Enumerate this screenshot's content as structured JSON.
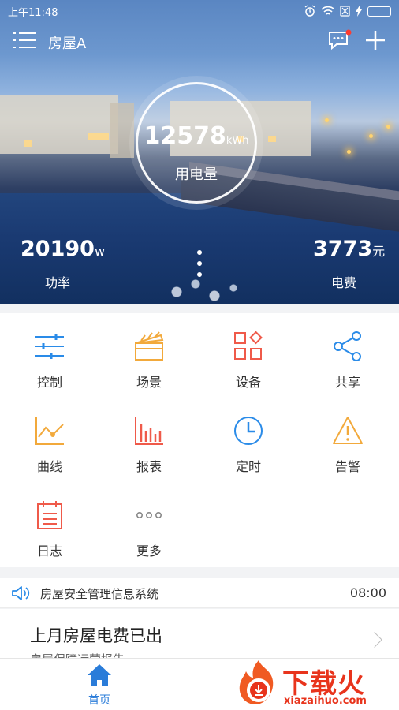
{
  "status_bar": {
    "time": "上午11:48",
    "battery_level": 1.0
  },
  "header": {
    "house_name": "房屋A",
    "has_unread_messages": true
  },
  "summary": {
    "energy": {
      "value": "12578",
      "unit": "kWh",
      "label": "用电量"
    },
    "power": {
      "value": "20190",
      "unit": "w",
      "label": "功率"
    },
    "cost": {
      "value": "3773",
      "unit": "元",
      "label": "电费"
    }
  },
  "functions": [
    {
      "label": "控制",
      "icon": "sliders-icon",
      "color": "#2a8be8"
    },
    {
      "label": "场景",
      "icon": "clapperboard-icon",
      "color": "#f2a93b"
    },
    {
      "label": "设备",
      "icon": "devices-grid-icon",
      "color": "#ef5a4a"
    },
    {
      "label": "共享",
      "icon": "share-icon",
      "color": "#2a8be8"
    },
    {
      "label": "曲线",
      "icon": "line-chart-icon",
      "color": "#f2a93b"
    },
    {
      "label": "报表",
      "icon": "bar-chart-icon",
      "color": "#ef5a4a"
    },
    {
      "label": "定时",
      "icon": "clock-icon",
      "color": "#2a8be8"
    },
    {
      "label": "告警",
      "icon": "warning-icon",
      "color": "#f2a93b"
    },
    {
      "label": "日志",
      "icon": "calendar-icon",
      "color": "#ef5a4a"
    },
    {
      "label": "更多",
      "icon": "more-icon",
      "color": "#888888"
    }
  ],
  "notice": {
    "text": "房屋安全管理信息系统",
    "time": "08:00"
  },
  "message_card": {
    "title": "上月房屋电费已出",
    "subtitle": "房屋保障运营报告"
  },
  "tabbar": {
    "home_label": "首页"
  },
  "watermark": {
    "name": "下载火",
    "url": "xiazaihuo.com"
  }
}
